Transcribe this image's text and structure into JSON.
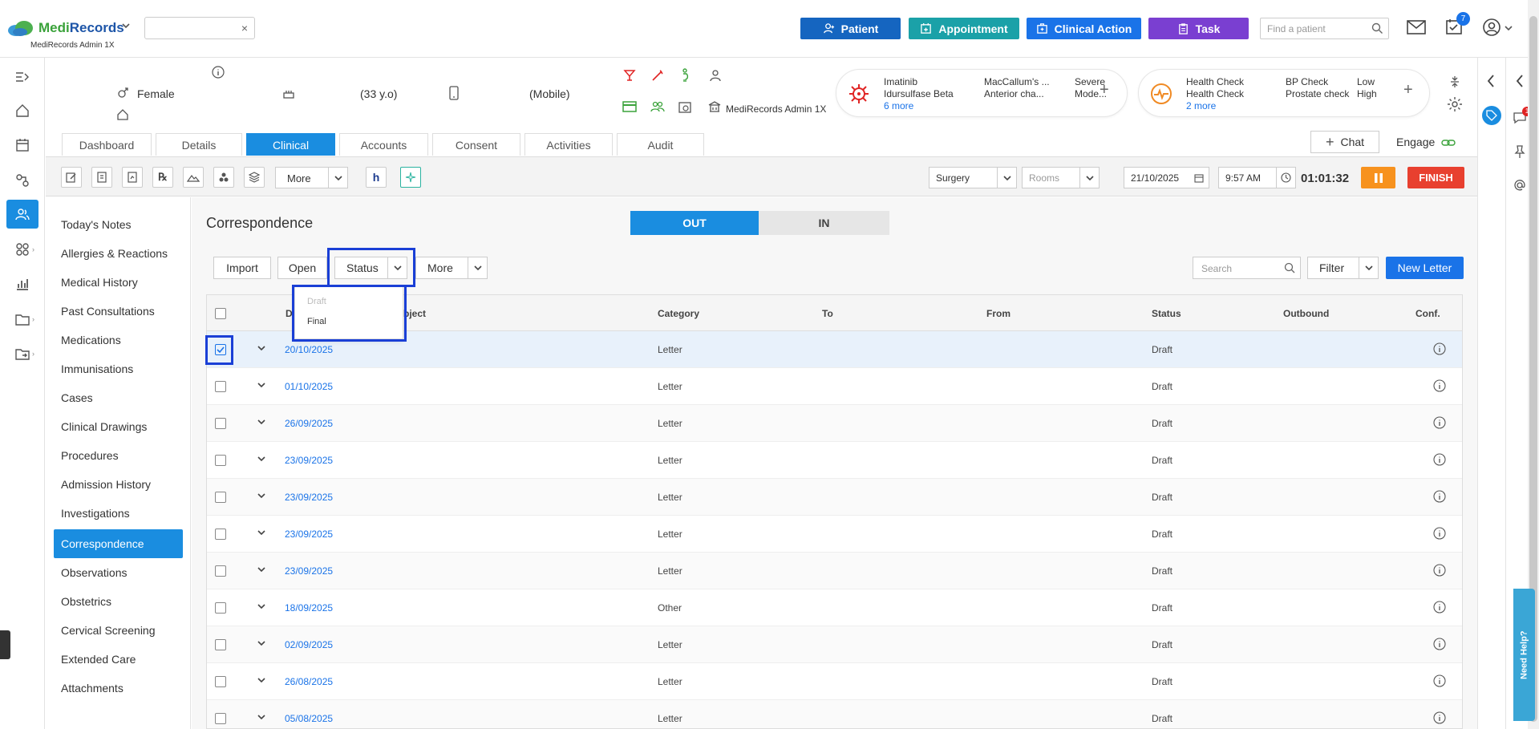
{
  "header": {
    "brand_part1": "Medi",
    "brand_part2": "Records",
    "brand_sub": "MediRecords Admin 1X",
    "top_search_clear": "×",
    "buttons": {
      "patient": "Patient",
      "appointment": "Appointment",
      "clinical_action": "Clinical Action",
      "task": "Task"
    },
    "find_patient_placeholder": "Find a patient",
    "tasks_badge": "7",
    "colors": {
      "patient": "#1565c0",
      "appointment": "#1ba1a8",
      "clinical_action": "#1a73e8",
      "task": "#7a3fd1"
    }
  },
  "patient": {
    "gender": "Female",
    "age": "(33 y.o)",
    "phone": "(Mobile)",
    "practice": "MediRecords Admin 1X"
  },
  "alerts": {
    "left": {
      "med1": "Imatinib",
      "med2": "Idursulfase Beta",
      "more": "6 more",
      "reaction1": "MacCallum's ...",
      "reaction2": "Anterior cha...",
      "severity1": "Severe",
      "severity2": "Mode...",
      "add": "+"
    },
    "right": {
      "check1": "Health Check",
      "check2": "Health Check",
      "more": "2 more",
      "item1": "BP Check",
      "item2": "Prostate check",
      "level1": "Low",
      "level2": "High",
      "add": "+"
    }
  },
  "tabs": [
    "Dashboard",
    "Details",
    "Clinical",
    "Accounts",
    "Consent",
    "Activities",
    "Audit"
  ],
  "active_tab": "Clinical",
  "chat_label": "Chat",
  "engage_label": "Engage",
  "toolbar": {
    "more": "More",
    "location": "Surgery",
    "rooms": "Rooms",
    "date": "21/10/2025",
    "time": "9:57 AM",
    "timer": "01:01:32",
    "finish": "FINISH"
  },
  "sidebar": {
    "items": [
      "Today's Notes",
      "Allergies & Reactions",
      "Medical History",
      "Past Consultations",
      "Medications",
      "Immunisations",
      "Cases",
      "Clinical Drawings",
      "Procedures",
      "Admission History",
      "Investigations",
      "Correspondence",
      "Observations",
      "Obstetrics",
      "Cervical Screening",
      "Extended Care",
      "Attachments"
    ],
    "active": "Correspondence"
  },
  "main": {
    "title": "Correspondence",
    "toggle_out": "OUT",
    "toggle_in": "IN",
    "import": "Import",
    "open": "Open",
    "status": "Status",
    "more": "More",
    "search_placeholder": "Search",
    "filter": "Filter",
    "new_letter": "New Letter",
    "status_menu": {
      "draft": "Draft",
      "final": "Final"
    }
  },
  "table": {
    "columns": {
      "date": "Da",
      "subject": "bject",
      "category": "Category",
      "to": "To",
      "from": "From",
      "status": "Status",
      "outbound": "Outbound",
      "conf": "Conf."
    },
    "rows": [
      {
        "date": "20/10/2025",
        "category": "Letter",
        "status": "Draft"
      },
      {
        "date": "01/10/2025",
        "category": "Letter",
        "status": "Draft"
      },
      {
        "date": "26/09/2025",
        "category": "Letter",
        "status": "Draft"
      },
      {
        "date": "23/09/2025",
        "category": "Letter",
        "status": "Draft"
      },
      {
        "date": "23/09/2025",
        "category": "Letter",
        "status": "Draft"
      },
      {
        "date": "23/09/2025",
        "category": "Letter",
        "status": "Draft"
      },
      {
        "date": "23/09/2025",
        "category": "Letter",
        "status": "Draft"
      },
      {
        "date": "18/09/2025",
        "category": "Other",
        "status": "Draft"
      },
      {
        "date": "02/09/2025",
        "category": "Letter",
        "status": "Draft"
      },
      {
        "date": "26/08/2025",
        "category": "Letter",
        "status": "Draft"
      },
      {
        "date": "05/08/2025",
        "category": "Letter",
        "status": "Draft"
      }
    ]
  },
  "right_rail": {
    "notification_badge": "1",
    "need_help": "Need Help?"
  }
}
